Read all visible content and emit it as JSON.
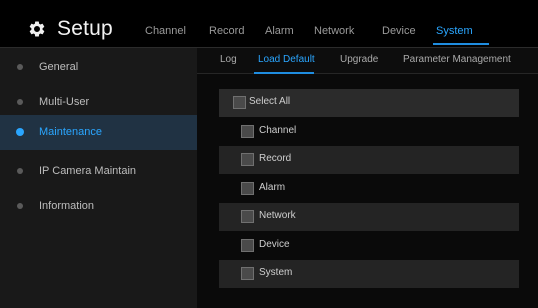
{
  "app": {
    "title": "Setup",
    "icon": "gear-icon"
  },
  "top_nav": {
    "items": [
      "Channel",
      "Record",
      "Alarm",
      "Network",
      "Device",
      "System"
    ],
    "active": "System"
  },
  "sidebar": {
    "items": [
      "General",
      "Multi-User",
      "Maintenance",
      "IP Camera Maintain",
      "Information"
    ],
    "active": "Maintenance"
  },
  "subtabs": {
    "items": [
      "Log",
      "Load Default",
      "Upgrade",
      "Parameter Management"
    ],
    "active": "Load Default"
  },
  "checklist": {
    "select_all": "Select All",
    "items": [
      "Channel",
      "Record",
      "Alarm",
      "Network",
      "Device",
      "System"
    ]
  },
  "colors": {
    "accent": "#2aa6ff",
    "active_sidebar_bg": "#203243"
  }
}
